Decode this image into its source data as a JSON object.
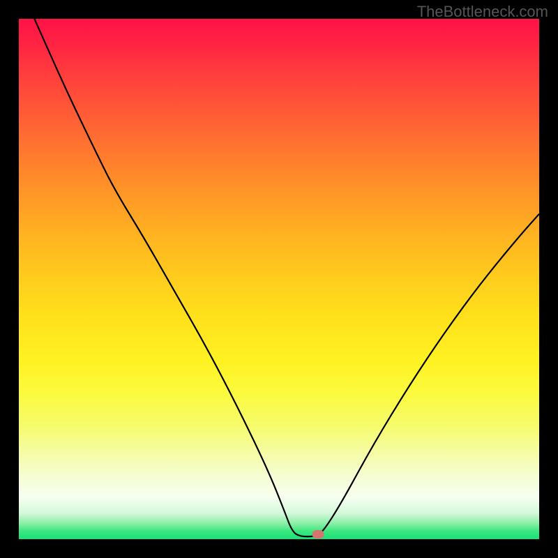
{
  "watermark": "TheBottleneck.com",
  "chart_data": {
    "type": "line",
    "title": "",
    "xlabel": "",
    "ylabel": "",
    "xlim": [
      0,
      100
    ],
    "ylim": [
      0,
      100
    ],
    "background": {
      "type": "vertical-gradient",
      "stops": [
        {
          "pos": 0.0,
          "color": "#ff1348"
        },
        {
          "pos": 0.5,
          "color": "#ffcd1d"
        },
        {
          "pos": 0.9,
          "color": "#f6fef0"
        },
        {
          "pos": 1.0,
          "color": "#18df78"
        }
      ]
    },
    "series": [
      {
        "name": "bottleneck-curve",
        "color": "#000000",
        "points": [
          {
            "x": 3.0,
            "y": 100.0
          },
          {
            "x": 9.0,
            "y": 86.5
          },
          {
            "x": 15.0,
            "y": 74.0
          },
          {
            "x": 18.5,
            "y": 67.0
          },
          {
            "x": 24.0,
            "y": 58.0
          },
          {
            "x": 30.0,
            "y": 47.5
          },
          {
            "x": 36.0,
            "y": 37.0
          },
          {
            "x": 42.0,
            "y": 25.5
          },
          {
            "x": 48.0,
            "y": 13.0
          },
          {
            "x": 51.0,
            "y": 5.5
          },
          {
            "x": 52.5,
            "y": 1.5
          },
          {
            "x": 54.0,
            "y": 0.5
          },
          {
            "x": 57.0,
            "y": 0.5
          },
          {
            "x": 58.5,
            "y": 1.5
          },
          {
            "x": 62.0,
            "y": 7.0
          },
          {
            "x": 68.0,
            "y": 18.0
          },
          {
            "x": 75.0,
            "y": 29.5
          },
          {
            "x": 82.0,
            "y": 40.0
          },
          {
            "x": 89.0,
            "y": 49.5
          },
          {
            "x": 96.0,
            "y": 58.0
          },
          {
            "x": 100.0,
            "y": 62.5
          }
        ]
      }
    ],
    "markers": [
      {
        "name": "optimal-point",
        "x": 57.5,
        "y": 1.0,
        "color": "#d4766f"
      }
    ]
  }
}
